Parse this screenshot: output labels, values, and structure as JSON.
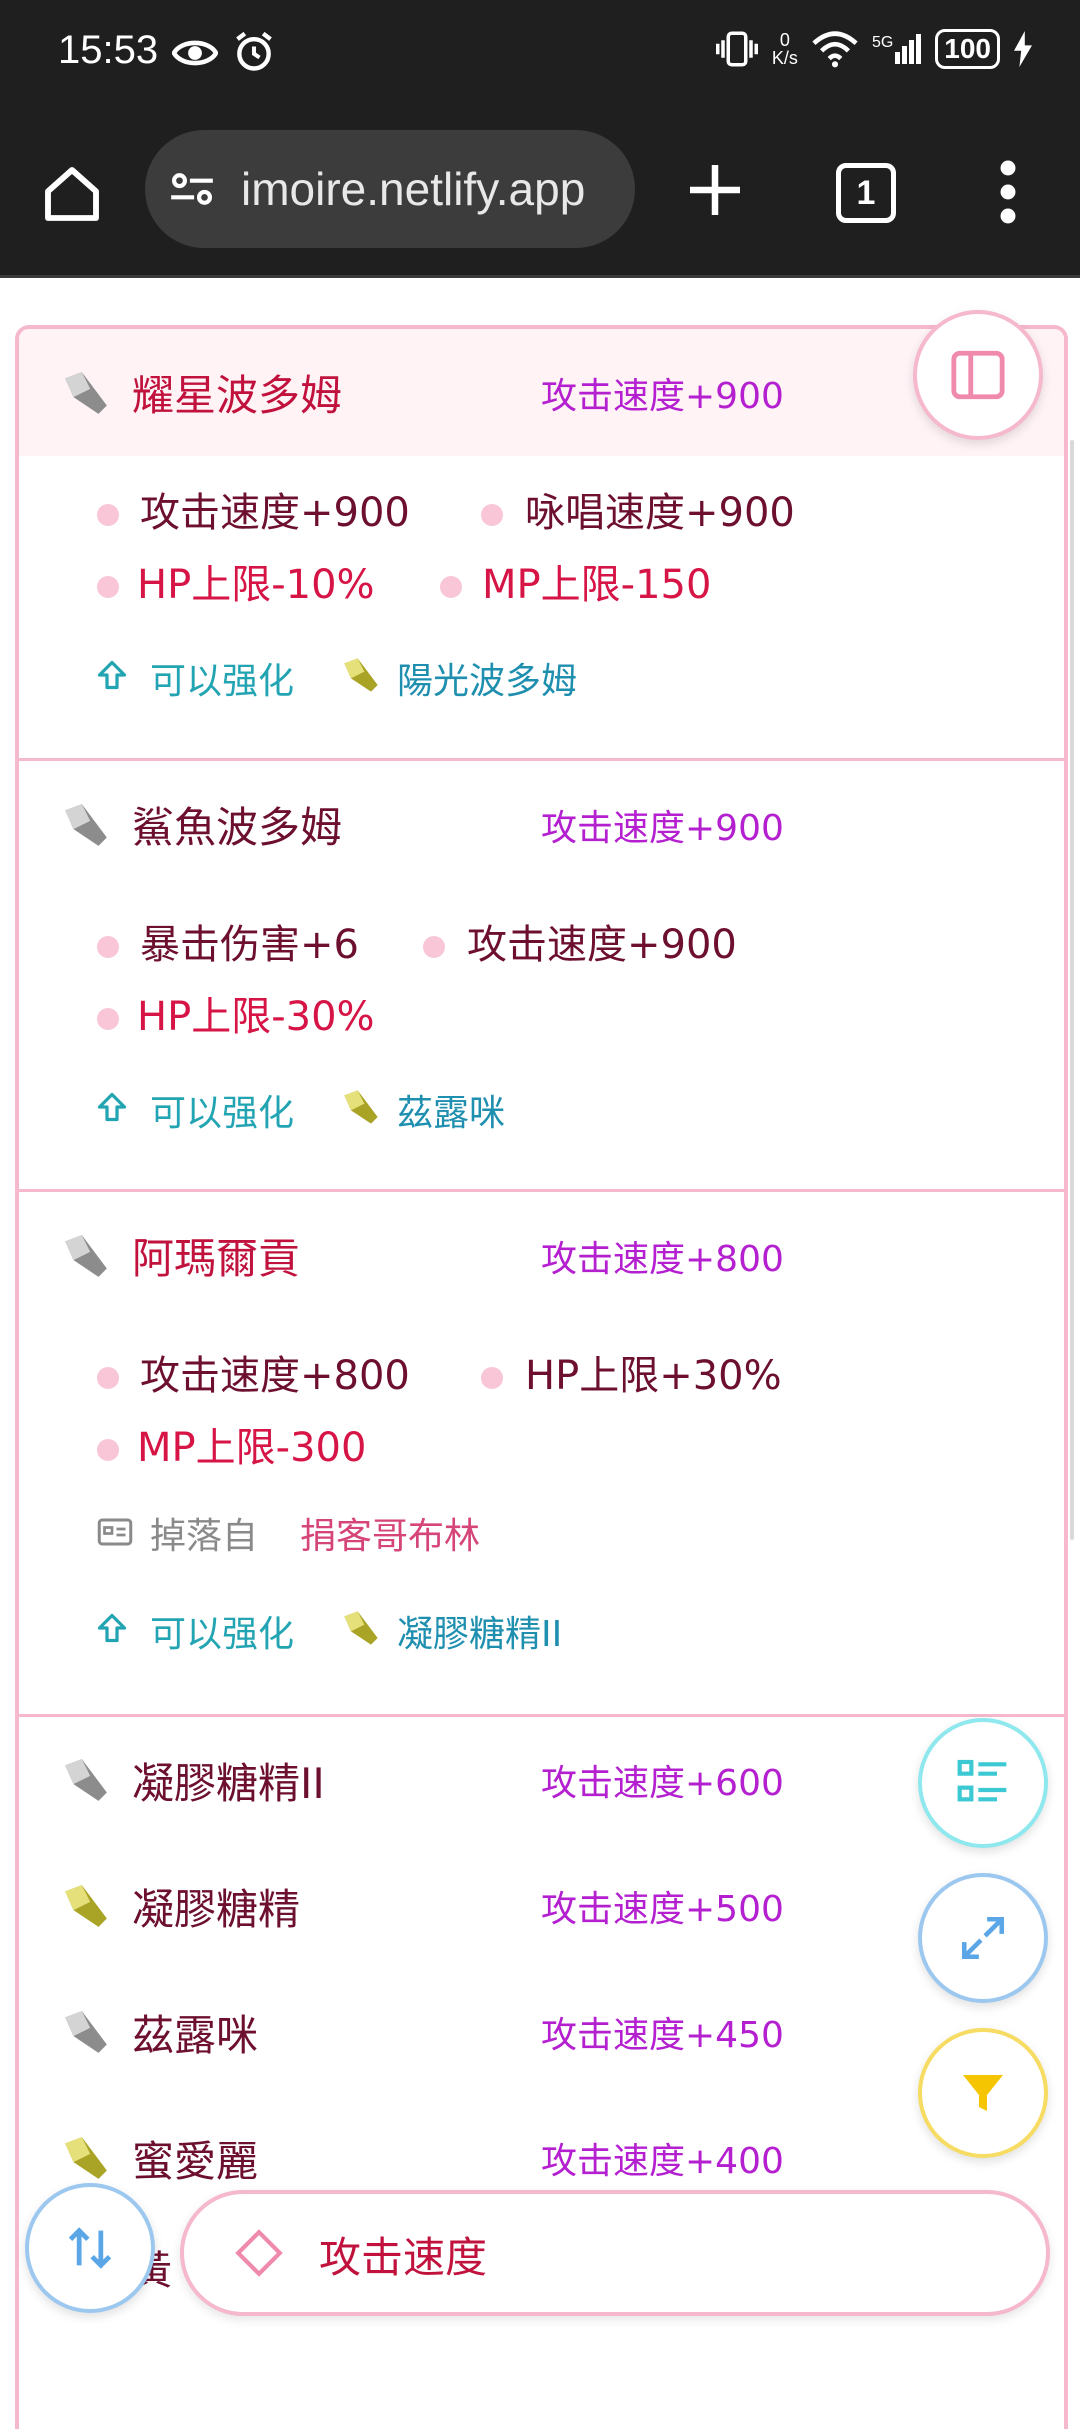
{
  "status_bar": {
    "time": "15:53",
    "net_speed_value": "0",
    "net_speed_unit": "K/s",
    "signal_label": "5G",
    "battery": "100"
  },
  "browser": {
    "url": "imoire.netlify.app",
    "tab_count": "1"
  },
  "cards": [
    {
      "name": "耀星波多姆",
      "stat": "攻击速度+900",
      "gem_color": "gray",
      "stats_rows": [
        [
          {
            "text": "攻击速度+900",
            "neg": false
          },
          {
            "text": "咏唱速度+900",
            "neg": false
          }
        ],
        [
          {
            "text": "HP上限-10%",
            "neg": true
          },
          {
            "text": "MP上限-150",
            "neg": true
          }
        ]
      ],
      "enhance_label": "可以强化",
      "enhance_target": "陽光波多姆"
    },
    {
      "name": "鯊魚波多姆",
      "stat": "攻击速度+900",
      "gem_color": "gray",
      "stats_rows": [
        [
          {
            "text": "暴击伤害+6",
            "neg": false
          },
          {
            "text": "攻击速度+900",
            "neg": false
          }
        ],
        [
          {
            "text": "HP上限-30%",
            "neg": true
          }
        ]
      ],
      "enhance_label": "可以强化",
      "enhance_target": "茲露咪"
    },
    {
      "name": "阿瑪爾貢",
      "stat": "攻击速度+800",
      "gem_color": "gray",
      "stats_rows": [
        [
          {
            "text": "攻击速度+800",
            "neg": false
          },
          {
            "text": "HP上限+30%",
            "neg": false
          }
        ],
        [
          {
            "text": "MP上限-300",
            "neg": true
          }
        ]
      ],
      "drop_label": "掉落自",
      "drop_source": "捐客哥布林",
      "enhance_label": "可以强化",
      "enhance_target": "凝膠糖精II"
    }
  ],
  "simple_rows": [
    {
      "name": "凝膠糖精II",
      "stat": "攻击速度+600",
      "gem_color": "gray"
    },
    {
      "name": "凝膠糖精",
      "stat": "攻击速度+500",
      "gem_color": "yellow"
    },
    {
      "name": "茲露咪",
      "stat": "攻击速度+450",
      "gem_color": "gray"
    },
    {
      "name": "蜜愛麗",
      "stat": "攻击速度+400",
      "gem_color": "yellow"
    }
  ],
  "search": {
    "query": "攻击速度"
  },
  "peek_text": "黃"
}
